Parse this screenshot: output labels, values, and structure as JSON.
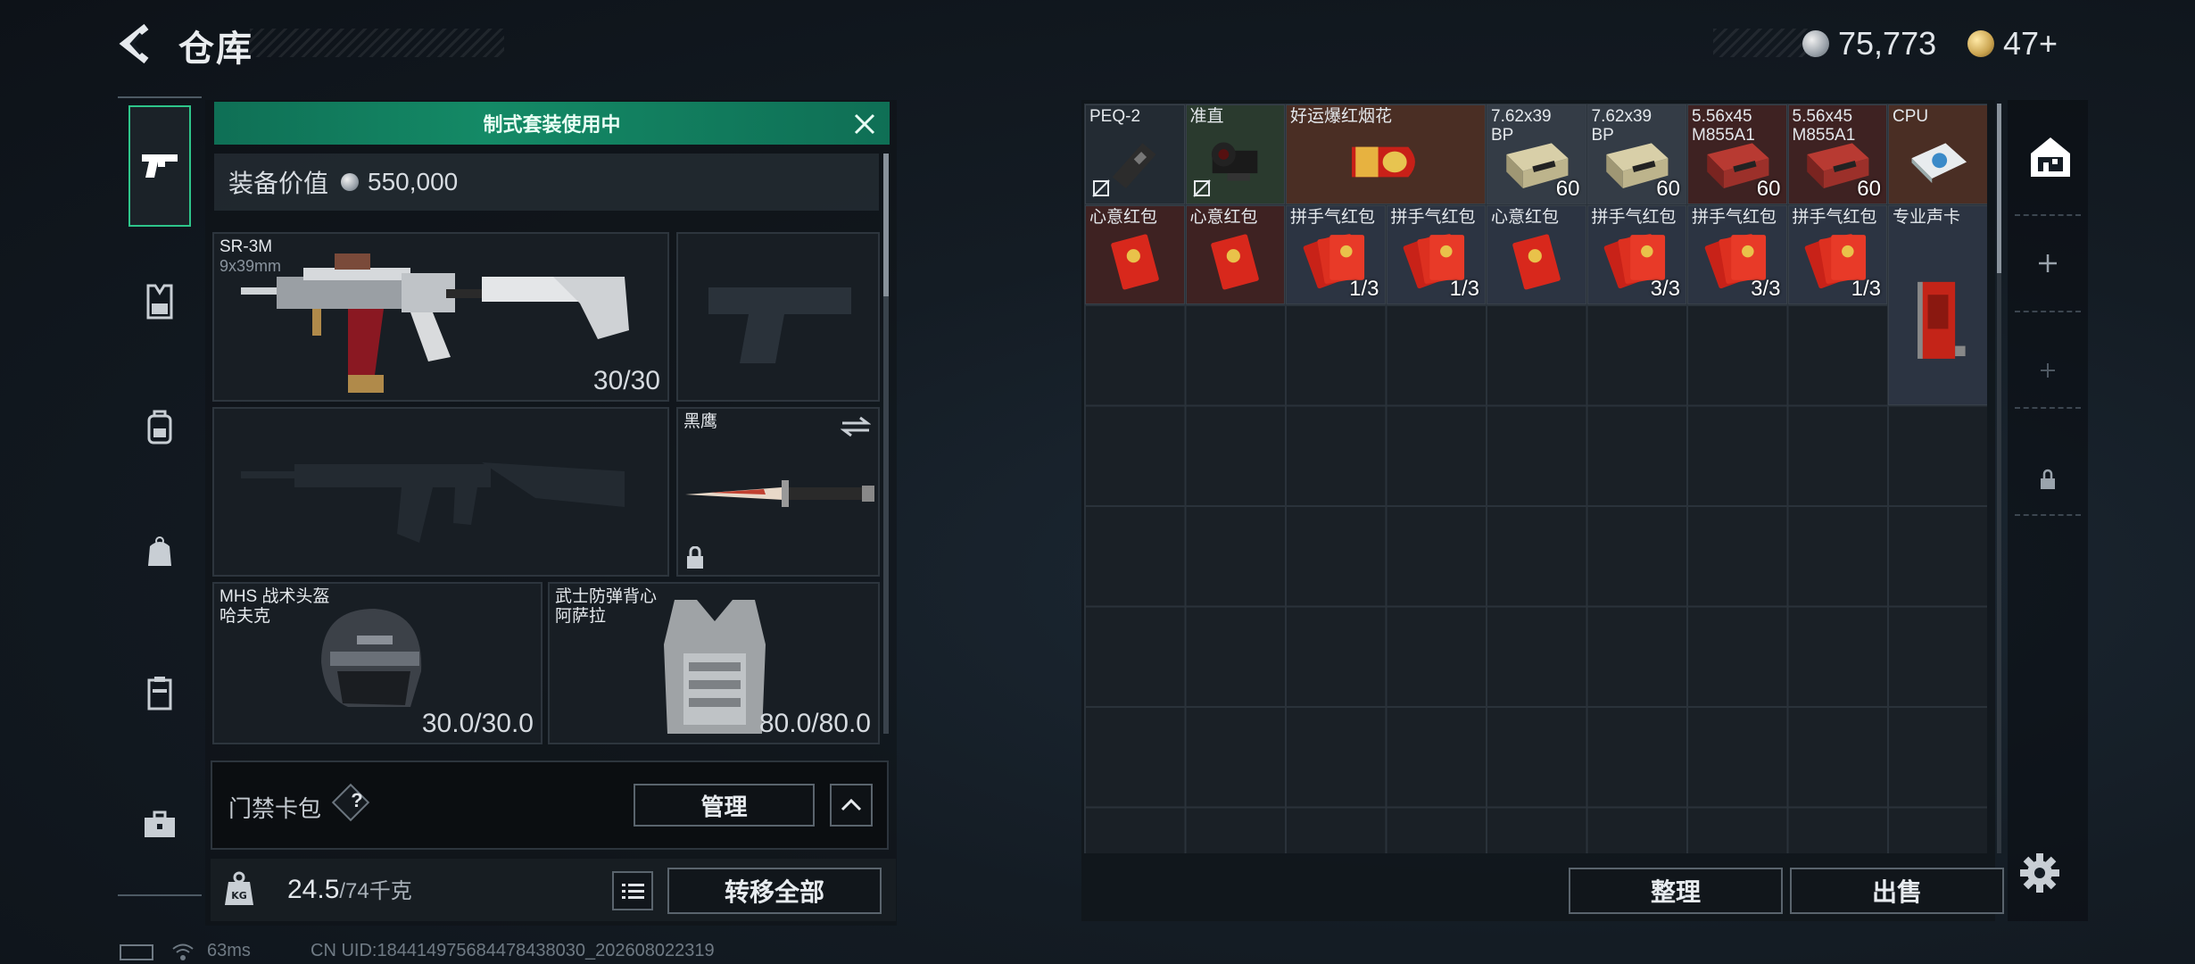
{
  "header": {
    "title": "仓库",
    "currencies": [
      {
        "value": "75,773",
        "icon": "silver-coin-icon"
      },
      {
        "value": "47+",
        "icon": "gold-triangle-coin-icon"
      }
    ]
  },
  "left_nav": {
    "items": [
      {
        "icon": "pistol-icon",
        "active": true
      },
      {
        "icon": "chest-rig-icon",
        "active": false
      },
      {
        "icon": "backpack-icon",
        "active": false
      },
      {
        "icon": "pouch-bag-icon",
        "active": false
      },
      {
        "icon": "safe-box-icon",
        "active": false
      },
      {
        "icon": "briefcase-icon",
        "active": false
      }
    ]
  },
  "loadout": {
    "banner": "制式套装使用中",
    "value_label": "装备价值",
    "value": "550,000",
    "primary": {
      "name": "SR-3M",
      "caliber": "9x39mm",
      "ammo": "30/30"
    },
    "secondary_pistol": {
      "name": ""
    },
    "secondary_rifle": {
      "name": ""
    },
    "melee": {
      "name": "黑鹰"
    },
    "helmet": {
      "name": "MHS 战术头盔\n哈夫克",
      "durability": "30.0/30.0"
    },
    "armor": {
      "name": "武士防弹背心\n阿萨拉",
      "durability": "80.0/80.0"
    },
    "access_card": {
      "label": "门禁卡包",
      "help": "?",
      "manage": "管理"
    },
    "weight": {
      "current": "24.5",
      "max": "/74千克"
    },
    "transfer_all": "转移全部"
  },
  "stash": {
    "items": [
      {
        "name": "PEQ-2",
        "qty": "",
        "bg": "bg-dark",
        "nomod": true,
        "icon": "peq2-laser-icon"
      },
      {
        "name": "准直",
        "qty": "",
        "bg": "bg-olive",
        "nomod": true,
        "icon": "red-dot-sight-icon"
      },
      {
        "name": "好运爆红烟花",
        "qty": "",
        "bg": "bg-brown",
        "nomod": false,
        "icon": "firecracker-icon",
        "wide": true
      },
      {
        "name": "7.62x39\nBP",
        "qty": "60",
        "bg": "bg-gray",
        "nomod": false,
        "icon": "ammo-box-icon"
      },
      {
        "name": "7.62x39\nBP",
        "qty": "60",
        "bg": "bg-gray",
        "nomod": false,
        "icon": "ammo-box-icon"
      },
      {
        "name": "5.56x45\nM855A1",
        "qty": "60",
        "bg": "bg-redb",
        "nomod": false,
        "icon": "ammo-box-red-icon"
      },
      {
        "name": "5.56x45\nM855A1",
        "qty": "60",
        "bg": "bg-redb",
        "nomod": false,
        "icon": "ammo-box-red-icon"
      },
      {
        "name": "CPU",
        "qty": "",
        "bg": "bg-brown",
        "nomod": false,
        "icon": "cpu-chip-icon"
      },
      {
        "name": "心意红包",
        "qty": "",
        "bg": "bg-redb",
        "nomod": false,
        "icon": "red-envelope-icon"
      },
      {
        "name": "心意红包",
        "qty": "",
        "bg": "bg-redb",
        "nomod": false,
        "icon": "red-envelope-icon"
      },
      {
        "name": "拼手气红包",
        "qty": "1/3",
        "bg": "bg-slate",
        "nomod": false,
        "icon": "red-envelope-stack-icon"
      },
      {
        "name": "拼手气红包",
        "qty": "1/3",
        "bg": "bg-slate",
        "nomod": false,
        "icon": "red-envelope-stack-icon"
      },
      {
        "name": "心意红包",
        "qty": "",
        "bg": "bg-slate",
        "nomod": false,
        "icon": "red-envelope-icon"
      },
      {
        "name": "拼手气红包",
        "qty": "3/3",
        "bg": "bg-slate",
        "nomod": false,
        "icon": "red-envelope-stack-icon"
      },
      {
        "name": "拼手气红包",
        "qty": "3/3",
        "bg": "bg-slate",
        "nomod": false,
        "icon": "red-envelope-stack-icon"
      },
      {
        "name": "拼手气红包",
        "qty": "1/3",
        "bg": "bg-slate",
        "nomod": false,
        "icon": "red-envelope-stack-icon"
      },
      {
        "name": "专业声卡",
        "qty": "",
        "bg": "bg-slate",
        "nomod": false,
        "icon": "sound-card-icon",
        "tall": true
      }
    ],
    "sort": "整理",
    "sell": "出售"
  },
  "status_bar": {
    "ping": "63ms",
    "uid": "CN UID:184414975684478438030_202608022319"
  }
}
